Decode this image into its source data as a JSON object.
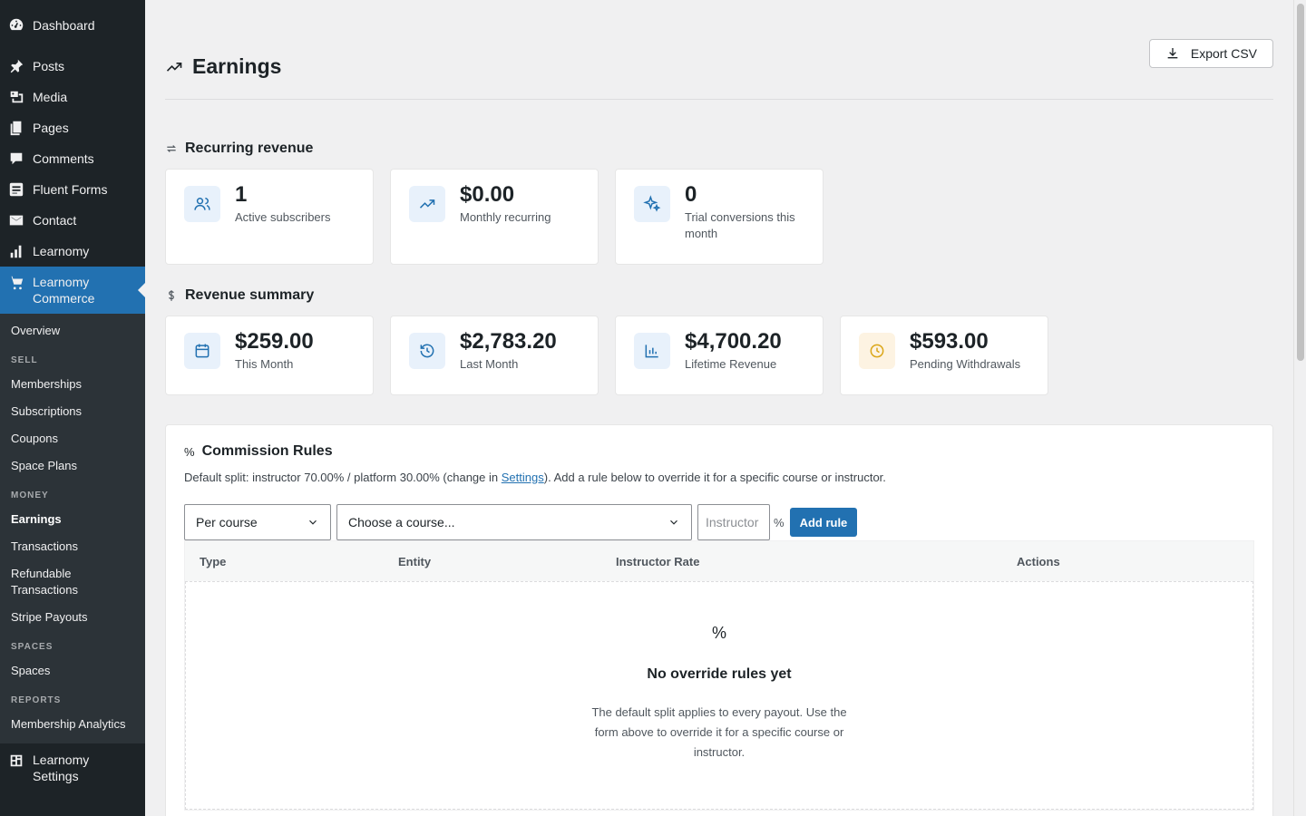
{
  "sidebar": {
    "top": [
      {
        "label": "Dashboard",
        "icon": "dashboard-icon"
      },
      {
        "label": "Posts",
        "icon": "pin-icon"
      },
      {
        "label": "Media",
        "icon": "media-icon"
      },
      {
        "label": "Pages",
        "icon": "pages-icon"
      },
      {
        "label": "Comments",
        "icon": "comment-icon"
      },
      {
        "label": "Fluent Forms",
        "icon": "forms-icon"
      },
      {
        "label": "Contact",
        "icon": "mail-icon"
      },
      {
        "label": "Learnomy",
        "icon": "chart-bars-icon"
      }
    ],
    "active": {
      "label": "Learnomy Commerce",
      "icon": "cart-icon"
    },
    "submenu": {
      "overview": "Overview",
      "sell_head": "SELL",
      "sell": [
        "Memberships",
        "Subscriptions",
        "Coupons",
        "Space Plans"
      ],
      "money_head": "MONEY",
      "money": [
        "Earnings",
        "Transactions",
        "Refundable Transactions",
        "Stripe Payouts"
      ],
      "spaces_head": "SPACES",
      "spaces": [
        "Spaces"
      ],
      "reports_head": "REPORTS",
      "reports": [
        "Membership Analytics"
      ]
    },
    "settings": {
      "label": "Learnomy Settings",
      "icon": "settings-grid-icon"
    }
  },
  "header": {
    "title": "Earnings",
    "export_label": "Export CSV"
  },
  "recurring": {
    "title": "Recurring revenue",
    "cards": [
      {
        "value": "1",
        "label": "Active subscribers",
        "icon": "users-icon"
      },
      {
        "value": "$0.00",
        "label": "Monthly recurring",
        "icon": "trend-up-icon"
      },
      {
        "value": "0",
        "label": "Trial conversions this month",
        "icon": "sparkle-icon"
      }
    ]
  },
  "summary": {
    "title": "Revenue summary",
    "cards": [
      {
        "value": "$259.00",
        "label": "This Month",
        "icon": "calendar-icon"
      },
      {
        "value": "$2,783.20",
        "label": "Last Month",
        "icon": "history-icon"
      },
      {
        "value": "$4,700.20",
        "label": "Lifetime Revenue",
        "icon": "bar-chart-icon"
      },
      {
        "value": "$593.00",
        "label": "Pending Withdrawals",
        "icon": "clock-icon"
      }
    ]
  },
  "commission": {
    "title": "Commission Rules",
    "desc_before": "Default split: instructor 70.00% / platform 30.00% (change in ",
    "desc_link": "Settings",
    "desc_after": "). Add a rule below to override it for a specific course or instructor.",
    "scope_value": "Per course",
    "course_value": "Choose a course...",
    "rate_placeholder": "Instructor",
    "pct": "%",
    "add_label": "Add rule",
    "columns": [
      "Type",
      "Entity",
      "Instructor Rate",
      "Actions"
    ],
    "empty_icon": "%",
    "empty_title": "No override rules yet",
    "empty_desc": "The default split applies to every payout. Use the form above to override it for a specific course or instructor."
  },
  "colors": {
    "accent": "#2271b1",
    "sidebar": "#1d2327",
    "warn": "#dba617"
  }
}
